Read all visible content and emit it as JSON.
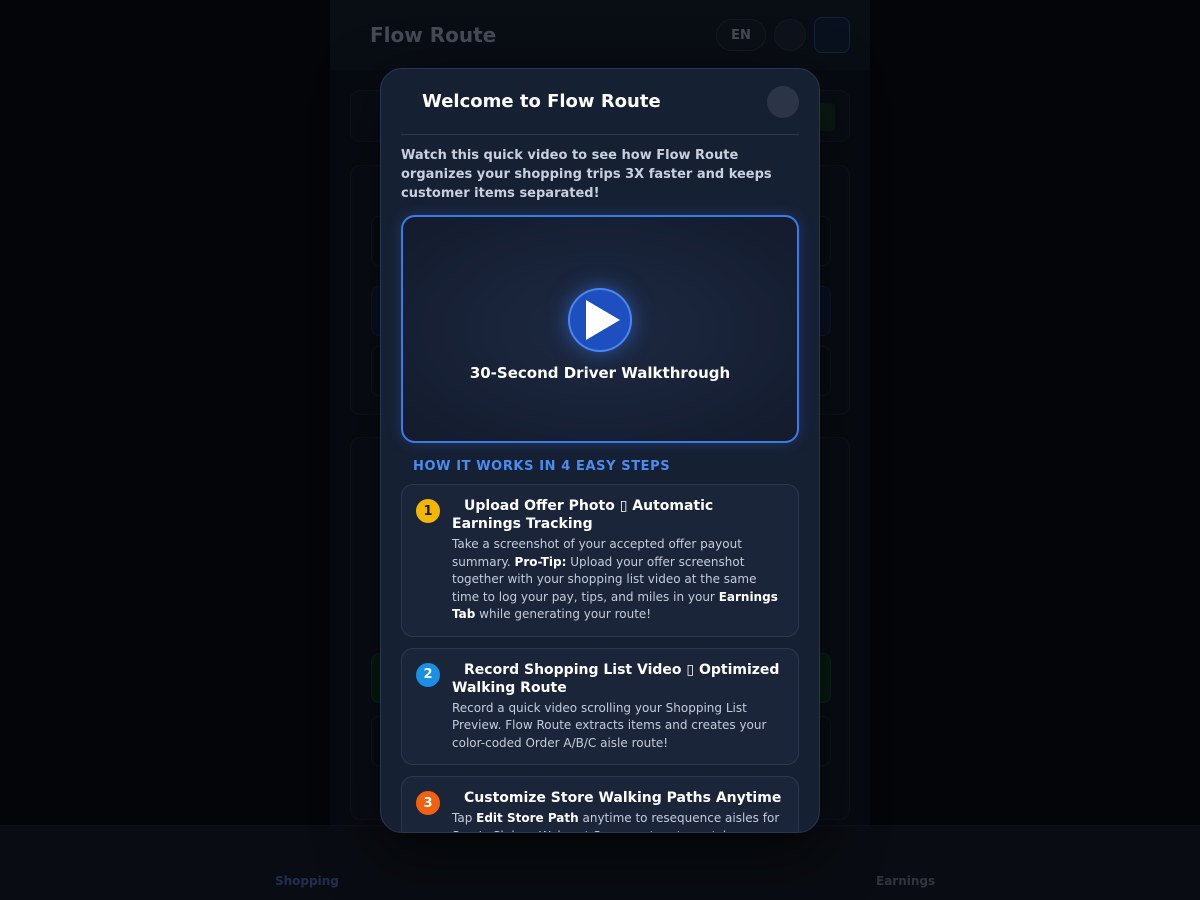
{
  "app": {
    "title": "Flow Route",
    "lang": "EN",
    "nav": {
      "shopping": "Shopping",
      "earnings": "Earnings"
    }
  },
  "modal": {
    "title": "Welcome to Flow Route",
    "intro": "Watch this quick video to see how Flow Route organizes your shopping trips 3X faster and keeps customer items separated!",
    "video_label": "30-Second Driver Walkthrough",
    "section_label": "HOW IT WORKS IN 4 EASY STEPS",
    "steps": [
      {
        "num": "1",
        "color": "#f2b705",
        "num_text_color": "#1a1a1a",
        "title": "Upload Offer Photo ▯ Automatic Earnings Tracking",
        "body_pre": "Take a screenshot of your accepted offer payout summary. ",
        "tip_label": "Pro-Tip:",
        "body_mid": " Upload your offer screenshot together with your shopping list video at the same time to log your pay, tips, and miles in your ",
        "bold_term": "Earnings Tab",
        "body_post": " while generating your route!"
      },
      {
        "num": "2",
        "color": "#1a8fe3",
        "num_text_color": "#ffffff",
        "title": "Record Shopping List Video ▯ Optimized Walking Route",
        "body": "Record a quick video scrolling your Shopping List Preview. Flow Route extracts items and creates your color-coded Order A/B/C aisle route!"
      },
      {
        "num": "3",
        "color": "#f0620e",
        "num_text_color": "#ffffff",
        "title": "Customize Store Walking Paths Anytime",
        "body_pre": "Tap ",
        "bold_term": "Edit Store Path",
        "body_post": " anytime to resequence aisles for Sam's Club or Walmart Supercenters to match your personal walking order!"
      }
    ]
  },
  "colors": {
    "accent": "#3b7be8",
    "modal_bg": "#162033"
  }
}
